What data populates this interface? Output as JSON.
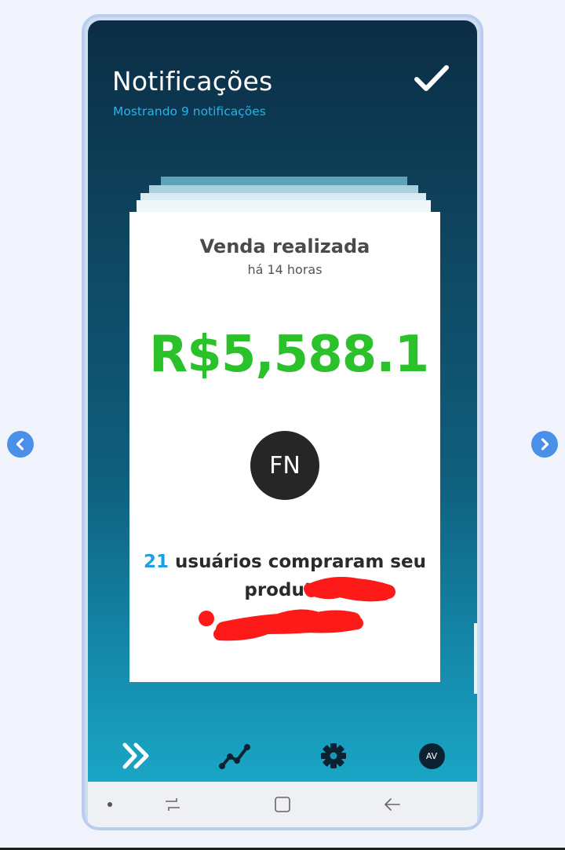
{
  "header": {
    "title": "Notificações",
    "subtitle": "Mostrando 9 notificações",
    "check_icon": "check-icon"
  },
  "card": {
    "title": "Venda realizada",
    "time": "há 14 horas",
    "amount": "R$5,588.1...",
    "avatar_initials": "FN",
    "message_count": "21",
    "message_text": " usuários compraram seu produto",
    "message_product_redacted": "",
    "colors": {
      "amount": "#2bc12b",
      "accent": "#1e9fe0",
      "redaction": "#ff1a1a"
    }
  },
  "tabbar": {
    "items": [
      {
        "icon": "notifications-icon"
      },
      {
        "icon": "stats-icon"
      },
      {
        "icon": "settings-icon"
      },
      {
        "icon": "avatar",
        "initials": "AV"
      }
    ]
  },
  "navbar": {
    "items": [
      {
        "icon": "dot-icon"
      },
      {
        "icon": "recent-apps-icon"
      },
      {
        "icon": "home-icon"
      },
      {
        "icon": "back-icon"
      }
    ]
  },
  "pager": {
    "prev_icon": "chevron-left-icon",
    "next_icon": "chevron-right-icon"
  }
}
